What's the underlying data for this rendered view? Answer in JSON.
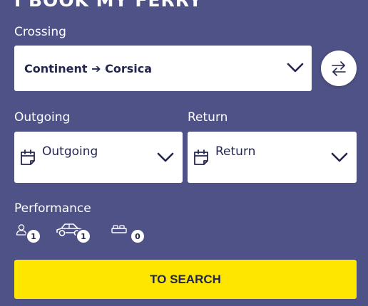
{
  "heading": "I BOOK MY FERRY",
  "crossing": {
    "label": "Crossing",
    "value": "Continent ➔ Corsica"
  },
  "outgoing": {
    "label": "Outgoing",
    "placeholder": "Outgoing"
  },
  "return": {
    "label": "Return",
    "placeholder": "Return"
  },
  "performance": {
    "label": "Performance",
    "passengers": "1",
    "vehicles": "1",
    "cabins": "0"
  },
  "search_label": "TO SEARCH",
  "colors": {
    "background": "#4f5287",
    "accent": "#ffe600",
    "text_dark": "#23264f"
  },
  "icons": [
    "chevron-down-icon",
    "swap-icon",
    "calendar-icon",
    "person-icon",
    "car-icon",
    "bed-icon"
  ]
}
